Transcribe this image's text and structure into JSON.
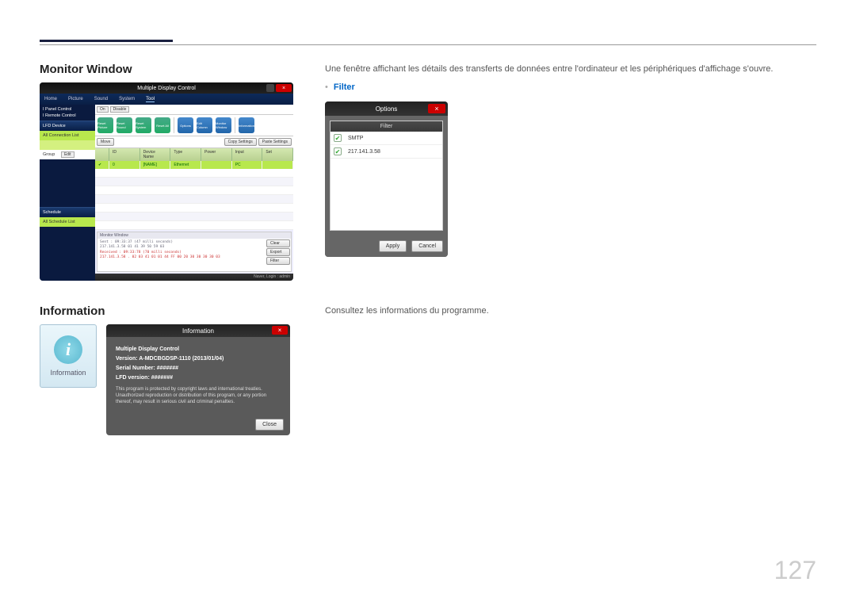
{
  "page_number": "127",
  "sections": {
    "monitor": {
      "heading": "Monitor Window",
      "desc": "Une fenêtre affichant les détails des transferts de données entre l'ordinateur et les périphériques d'affichage s'ouvre.",
      "filter_label": "Filter"
    },
    "information": {
      "heading": "Information",
      "desc": "Consultez les informations du programme."
    }
  },
  "mdc": {
    "title": "Multiple Display Control",
    "nav": [
      "Home",
      "Picture",
      "Sound",
      "System",
      "Tool"
    ],
    "panel_label": "I Panel Control",
    "remote_label": "I Remote Control",
    "panel_value": "On",
    "remote_value": "Disable",
    "tool_icons": [
      "Reset Picture",
      "Reset Sound",
      "Reset System",
      "Reset All",
      "Options",
      "Edit Column",
      "Monitor Window",
      "Information"
    ],
    "row_btns": [
      "Move",
      "Copy Settings",
      "Paste Settings"
    ],
    "sidebar": {
      "lfd": "LFD Device",
      "all_conn": "All Connection List",
      "group": "Group",
      "edit": "Edit",
      "schedule": "Schedule",
      "all_sched": "All Schedule List"
    },
    "table": {
      "headers": [
        "ID",
        "Device Name",
        "Type",
        "Power",
        "Input",
        "Set"
      ],
      "row": [
        "0",
        "[NAME]",
        "Ethernet",
        "",
        "PC",
        ""
      ]
    },
    "monitor_panel": {
      "title": "Monitor Window",
      "line1": "Sent : 09:33:37 (47 milli seconds)",
      "line2": "217.141.3.58 01 41 39 50 59 03",
      "line3": "Received : 09:33:78 (70 milli seconds)",
      "line4": "217.141.3.58 . 02 03 41 01 01 44 FF 00 20 30 30 30 30 03",
      "btns": [
        "Clear",
        "Export",
        "Filter"
      ]
    },
    "footer": "Naver, Login : admin"
  },
  "filter_dialog": {
    "title": "Options",
    "header": "Filter",
    "items": [
      "SMTP",
      "217.141.3.58"
    ],
    "apply": "Apply",
    "cancel": "Cancel"
  },
  "info_card": {
    "label": "Information"
  },
  "info_dialog": {
    "title": "Information",
    "product": "Multiple Display Control",
    "version": "Version: A-MDCBGDSP-1110 (2013/01/04)",
    "serial": "Serial Number: #######",
    "lfd": "LFD version: #######",
    "legal": "This program is protected by copyright laws and international treaties. Unauthorized reproduction or distribution of this program, or any portion thereof, may result in serious civil and criminal penalties.",
    "close": "Close"
  }
}
